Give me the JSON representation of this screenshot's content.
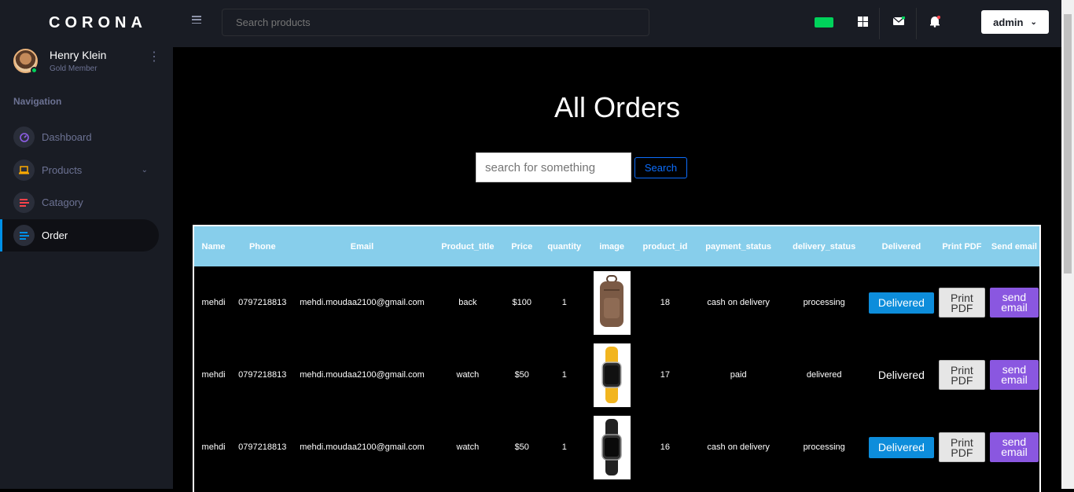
{
  "brand": "CORONA",
  "profile": {
    "name": "Henry Klein",
    "role": "Gold Member"
  },
  "nav": {
    "heading": "Navigation",
    "items": [
      {
        "label": "Dashboard",
        "icon": "speedometer-icon",
        "color": "#8f5fe8"
      },
      {
        "label": "Products",
        "icon": "laptop-icon",
        "color": "#ffab00",
        "has_submenu": true
      },
      {
        "label": "Catagory",
        "icon": "list-icon",
        "color": "#fc424a"
      },
      {
        "label": "Order",
        "icon": "list-icon",
        "color": "#0090e7",
        "active": true
      }
    ]
  },
  "topbar": {
    "search_placeholder": "Search products",
    "user_button": "admin"
  },
  "main": {
    "title": "All Orders",
    "search_placeholder": "search for something",
    "search_button": "Search"
  },
  "table": {
    "headers": [
      "Name",
      "Phone",
      "Email",
      "Product_title",
      "Price",
      "quantity",
      "image",
      "product_id",
      "payment_status",
      "delivery_status",
      "Delivered",
      "Print PDF",
      "Send email"
    ],
    "rows": [
      {
        "name": "mehdi",
        "phone": "0797218813",
        "email": "mehdi.moudaa2100@gmail.com",
        "product_title": "back",
        "price": "$100",
        "quantity": "1",
        "image": "backpack-image",
        "product_id": "18",
        "payment_status": "cash on delivery",
        "delivery_status": "processing",
        "delivered_label": "Delivered",
        "delivered_is_button": true,
        "pdf_label": "Print PDF",
        "email_label": "send email"
      },
      {
        "name": "mehdi",
        "phone": "0797218813",
        "email": "mehdi.moudaa2100@gmail.com",
        "product_title": "watch",
        "price": "$50",
        "quantity": "1",
        "image": "yellow-watch-image",
        "product_id": "17",
        "payment_status": "paid",
        "delivery_status": "delivered",
        "delivered_label": "Delivered",
        "delivered_is_button": false,
        "pdf_label": "Print PDF",
        "email_label": "send email"
      },
      {
        "name": "mehdi",
        "phone": "0797218813",
        "email": "mehdi.moudaa2100@gmail.com",
        "product_title": "watch",
        "price": "$50",
        "quantity": "1",
        "image": "black-watch-image",
        "product_id": "16",
        "payment_status": "cash on delivery",
        "delivery_status": "processing",
        "delivered_label": "Delivered",
        "delivered_is_button": true,
        "pdf_label": "Print PDF",
        "email_label": "send email"
      }
    ]
  },
  "colors": {
    "sidebar_bg": "#191c24",
    "table_header": "#87ceeb",
    "delivered_btn": "#0d8ddb",
    "email_btn": "#8a57e0",
    "online": "#00d25b"
  }
}
